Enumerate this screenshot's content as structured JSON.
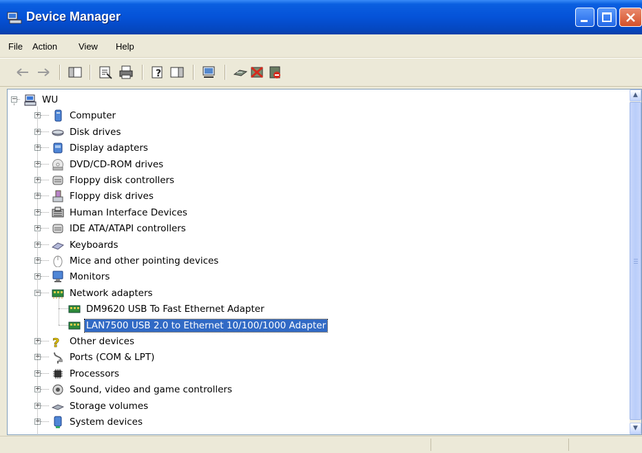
{
  "window": {
    "title": "Device Manager"
  },
  "menu": [
    {
      "label": "File"
    },
    {
      "label": "Action"
    },
    {
      "label": "View"
    },
    {
      "label": "Help"
    }
  ],
  "toolbar": {
    "buttons": [
      "back-icon",
      "forward-icon",
      "show-hide-console-tree-icon",
      "properties-icon",
      "print-icon",
      "help-icon",
      "show-hide-action-pane-icon",
      "scan-hardware-icon",
      "update-driver-icon",
      "uninstall-icon",
      "disable-icon"
    ]
  },
  "tree": {
    "root": {
      "label": "WU"
    },
    "categories": [
      {
        "label": "Computer",
        "icon": "computer-icon"
      },
      {
        "label": "Disk drives",
        "icon": "disk-drive-icon"
      },
      {
        "label": "Display adapters",
        "icon": "display-adapter-icon"
      },
      {
        "label": "DVD/CD-ROM drives",
        "icon": "dvd-icon"
      },
      {
        "label": "Floppy disk controllers",
        "icon": "controller-icon"
      },
      {
        "label": "Floppy disk drives",
        "icon": "floppy-icon"
      },
      {
        "label": "Human Interface Devices",
        "icon": "hid-icon"
      },
      {
        "label": "IDE ATA/ATAPI controllers",
        "icon": "controller-icon"
      },
      {
        "label": "Keyboards",
        "icon": "keyboard-icon"
      },
      {
        "label": "Mice and other pointing devices",
        "icon": "mouse-icon"
      },
      {
        "label": "Monitors",
        "icon": "monitor-icon"
      },
      {
        "label": "Network adapters",
        "icon": "network-adapter-icon",
        "expanded": true,
        "children": [
          {
            "label": "DM9620 USB To Fast Ethernet Adapter"
          },
          {
            "label": "LAN7500 USB 2.0 to Ethernet 10/100/1000 Adapter",
            "selected": true
          }
        ]
      },
      {
        "label": "Other devices",
        "icon": "unknown-device-icon"
      },
      {
        "label": "Ports (COM & LPT)",
        "icon": "port-icon"
      },
      {
        "label": "Processors",
        "icon": "processor-icon"
      },
      {
        "label": "Sound, video and game controllers",
        "icon": "sound-icon"
      },
      {
        "label": "Storage volumes",
        "icon": "storage-icon"
      },
      {
        "label": "System devices",
        "icon": "system-device-icon"
      }
    ]
  },
  "colors": {
    "title_bar": "#0552d8",
    "selection": "#316ac5",
    "chrome": "#ece9d8"
  }
}
